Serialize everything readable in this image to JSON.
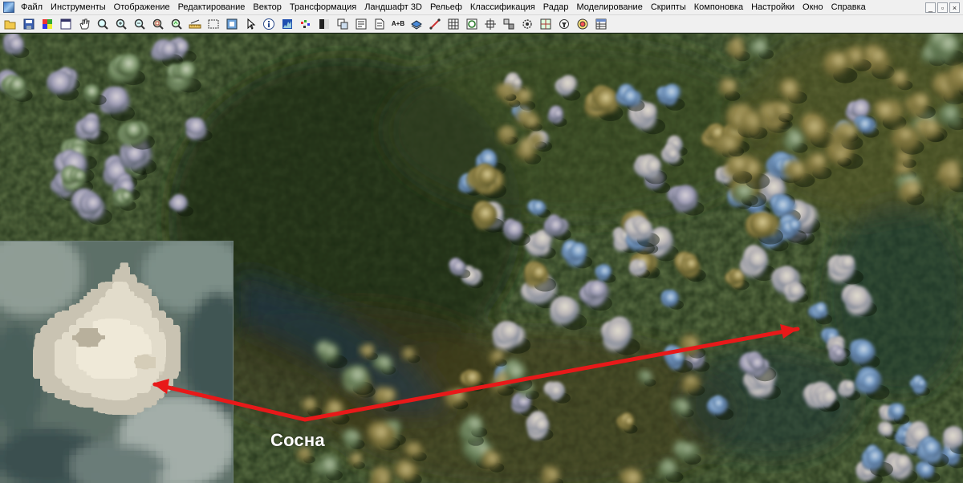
{
  "menu": {
    "items": [
      {
        "id": "file",
        "label": "Файл"
      },
      {
        "id": "tools",
        "label": "Инструменты"
      },
      {
        "id": "display",
        "label": "Отображение"
      },
      {
        "id": "edit",
        "label": "Редактирование"
      },
      {
        "id": "vector",
        "label": "Вектор"
      },
      {
        "id": "transform",
        "label": "Трансформация"
      },
      {
        "id": "landscape3d",
        "label": "Ландшафт 3D"
      },
      {
        "id": "relief",
        "label": "Рельеф"
      },
      {
        "id": "classification",
        "label": "Классификация"
      },
      {
        "id": "radar",
        "label": "Радар"
      },
      {
        "id": "modeling",
        "label": "Моделирование"
      },
      {
        "id": "scripts",
        "label": "Скрипты"
      },
      {
        "id": "layout",
        "label": "Компоновка"
      },
      {
        "id": "settings",
        "label": "Настройки"
      },
      {
        "id": "window",
        "label": "Окно"
      },
      {
        "id": "help",
        "label": "Справка"
      }
    ]
  },
  "window_controls": {
    "minimize": "_",
    "restore": "▫",
    "close": "×"
  },
  "toolbar": {
    "buttons": [
      {
        "icon": "open-folder-icon"
      },
      {
        "icon": "save-icon"
      },
      {
        "icon": "color-composite-icon"
      },
      {
        "icon": "window-view-icon"
      },
      {
        "icon": "pan-hand-icon"
      },
      {
        "icon": "zoom-icon"
      },
      {
        "icon": "zoom-in-icon"
      },
      {
        "icon": "zoom-out-icon"
      },
      {
        "icon": "zoom-fit-icon"
      },
      {
        "icon": "zoom-layer-icon"
      },
      {
        "icon": "ruler-icon"
      },
      {
        "icon": "select-rectangle-icon"
      },
      {
        "icon": "frame-icon"
      },
      {
        "icon": "cursor-icon"
      },
      {
        "icon": "info-icon"
      },
      {
        "icon": "histogram-icon"
      },
      {
        "icon": "pixel-icon"
      },
      {
        "icon": "contrast-icon"
      },
      {
        "icon": "bands-icon"
      },
      {
        "icon": "overlay-icon"
      },
      {
        "icon": "document-icon"
      },
      {
        "icon": "band-math-icon",
        "text": "A+B"
      },
      {
        "icon": "layers-icon"
      },
      {
        "icon": "measure-line-icon"
      },
      {
        "icon": "table-icon"
      },
      {
        "icon": "vector-grid-icon"
      },
      {
        "icon": "crosshair-icon"
      },
      {
        "icon": "mosaic-icon"
      },
      {
        "icon": "settings-gear-icon"
      },
      {
        "icon": "map-grid-icon"
      },
      {
        "icon": "filter-icon"
      },
      {
        "icon": "target-icon"
      },
      {
        "icon": "spreadsheet-icon"
      }
    ]
  },
  "annotation": {
    "label": "Сосна",
    "arrow_color": "#e81919"
  }
}
